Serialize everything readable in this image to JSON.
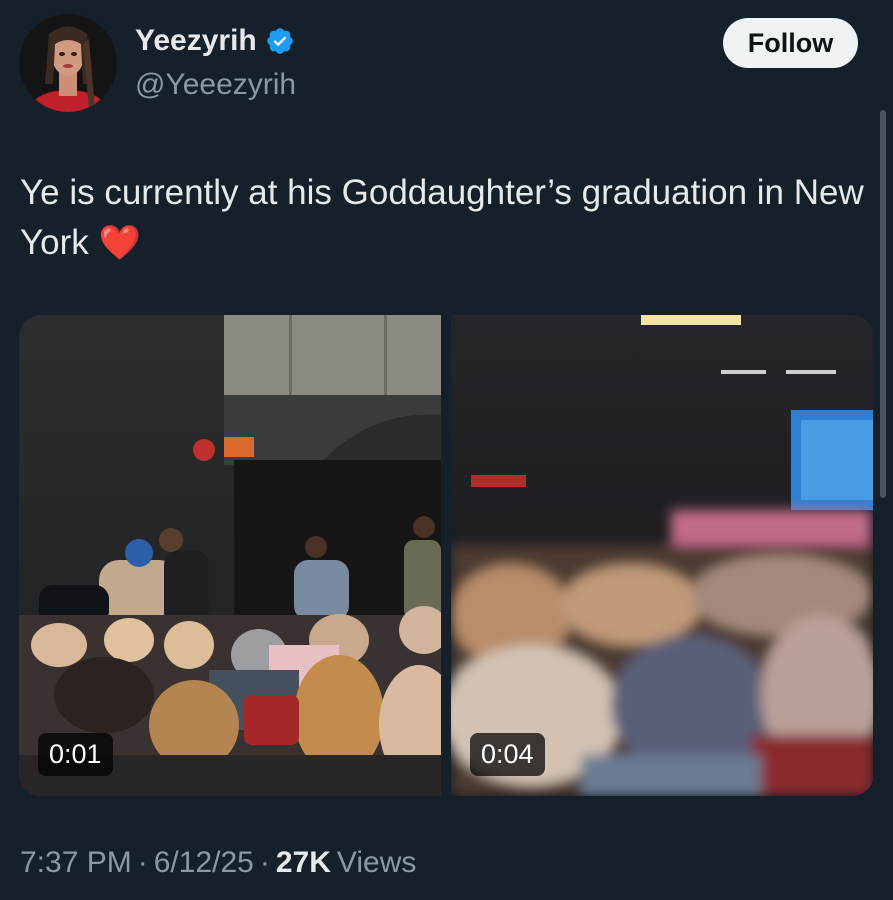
{
  "author": {
    "name": "Yeezyrih",
    "handle": "@Yeeezyrih",
    "verified": true,
    "avatar_icon": "profile-photo",
    "verified_color": "#1d9bf0"
  },
  "actions": {
    "follow_label": "Follow"
  },
  "tweet": {
    "text": "Ye is currently at his Goddaughter’s graduation in New York",
    "emoji": "❤️"
  },
  "media": [
    {
      "type": "video",
      "duration": "0:01"
    },
    {
      "type": "video",
      "duration": "0:04"
    }
  ],
  "meta": {
    "time": "7:37 PM",
    "separator": "·",
    "date": "6/12/25",
    "views_count": "27K",
    "views_label": "Views"
  },
  "colors": {
    "background": "#15202b",
    "text_primary": "#e7e9ea",
    "text_secondary": "#8b98a5",
    "follow_bg": "#eff3f4"
  }
}
